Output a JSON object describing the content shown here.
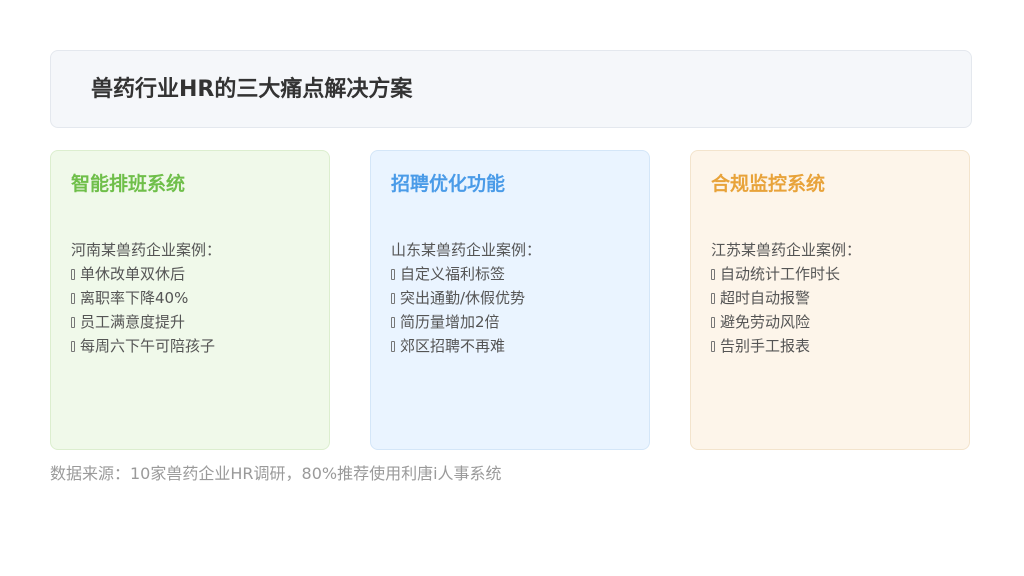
{
  "title": "兽药行业HR的三大痛点解决方案",
  "cards": [
    {
      "title": "智能排班系统",
      "case_label": "河南某兽药企业案例：",
      "items": [
        "单休改单双休后",
        "离职率下降40%",
        "员工满意度提升",
        "每周六下午可陪孩子"
      ],
      "accent": "#6fbf4a",
      "background": "#f0f9ea",
      "border": "#dceecf"
    },
    {
      "title": "招聘优化功能",
      "case_label": "山东某兽药企业案例：",
      "items": [
        "自定义福利标签",
        "突出通勤/休假优势",
        "简历量增加2倍",
        "郊区招聘不再难"
      ],
      "accent": "#4a9be8",
      "background": "#eaf4ff",
      "border": "#d4e6f8"
    },
    {
      "title": "合规监控系统",
      "case_label": "江苏某兽药企业案例：",
      "items": [
        "自动统计工作时长",
        "超时自动报警",
        "避免劳动风险",
        "告别手工报表"
      ],
      "accent": "#e8a33a",
      "background": "#fdf5ea",
      "border": "#f3e4cd"
    }
  ],
  "footer": "数据来源：10家兽药企业HR调研，80%推荐使用利唐i人事系统"
}
